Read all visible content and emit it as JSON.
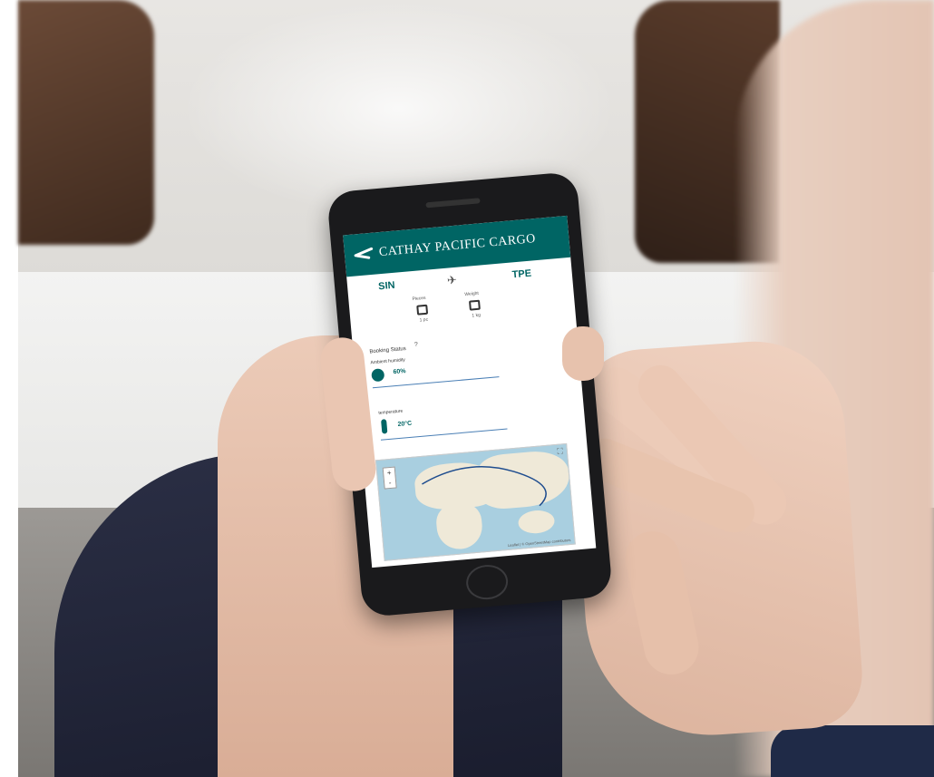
{
  "app": {
    "title": "CATHAY PACIFIC CARGO",
    "brand_color": "#006564"
  },
  "route": {
    "origin": "SIN",
    "destination": "TPE",
    "icon": "airplane-icon"
  },
  "shipment": {
    "pieces_label": "Pieces",
    "weight_label": "Weight",
    "pieces_value": "1 pc",
    "weight_value": "1 kg"
  },
  "status": {
    "label": "Booking Status",
    "humidity_label": "Ambient humidity",
    "humidity_value": "60%",
    "temperature_label": "temperature",
    "temperature_value": "20°C"
  },
  "map": {
    "zoom_in": "+",
    "zoom_out": "-",
    "attribution": "Leaflet | © OpenStreetMap contributors"
  }
}
